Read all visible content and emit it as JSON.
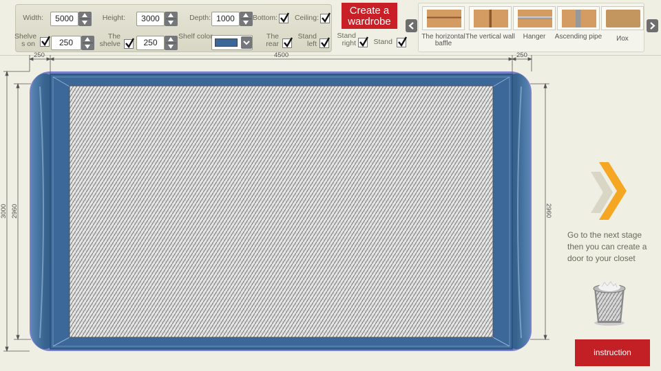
{
  "toolbar": {
    "width_label": "Width:",
    "width_value": "5000",
    "height_label": "Height:",
    "height_value": "3000",
    "depth_label": "Depth:",
    "depth_value": "1000",
    "bottom_label": "Bottom:",
    "bottom_checked": true,
    "ceiling_label": "Ceiling:",
    "ceiling_checked": true,
    "shelves_on_label": "Shelve s on",
    "shelves_on_checked": true,
    "shelves_on_value": "250",
    "the_shelve_label": "The shelve",
    "the_shelve_checked": true,
    "the_shelve_value": "250",
    "shelf_color_label": "Shelf color",
    "shelf_color_value": "#3b6898",
    "the_rear_label": "The rear",
    "the_rear_checked": true,
    "stand_left_label": "Stand left",
    "stand_left_checked": true,
    "stand_right_label": "Stand right",
    "stand_right_checked": true,
    "stand_label": "Stand",
    "stand_checked": true
  },
  "create_button": "Create a wardrobe",
  "components": [
    {
      "label": "The horizontal baffle",
      "icon": "horizontal-baffle-icon"
    },
    {
      "label": "The vertical wall",
      "icon": "vertical-wall-icon"
    },
    {
      "label": "Hanger",
      "icon": "hanger-icon"
    },
    {
      "label": "Ascending pipe",
      "icon": "ascending-pipe-icon"
    },
    {
      "label": "Иох",
      "icon": "box-icon"
    }
  ],
  "dimensions": {
    "left_width": "250",
    "inner_width": "4500",
    "right_width": "250",
    "total_height": "3000",
    "inner_height_left": "2960",
    "inner_height_right": "2960"
  },
  "next_stage_text": "Go to the next stage then you can create a door to your closet",
  "instruction_button": "instruction",
  "colors": {
    "accent_red": "#c92027",
    "wardrobe_blue": "#3b6898",
    "next_arrow_orange": "#f5a623",
    "background": "#efefe3"
  }
}
